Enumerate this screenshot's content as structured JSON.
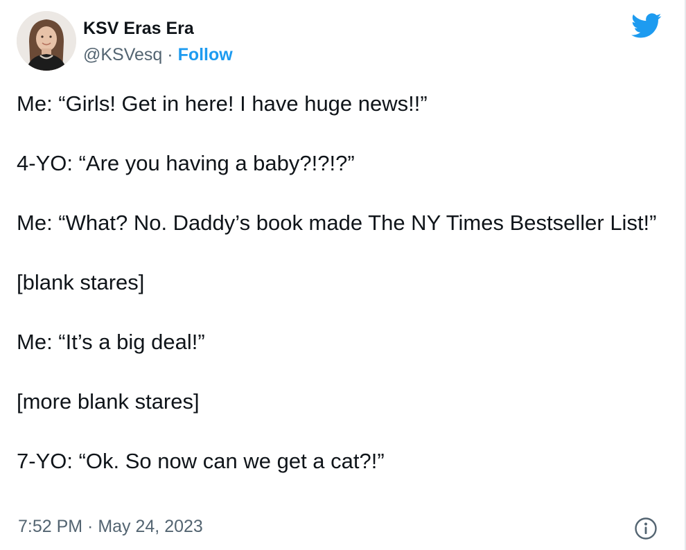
{
  "author": {
    "display_name": "KSV Eras Era",
    "handle": "@KSVesq",
    "separator": " · ",
    "follow_label": "Follow"
  },
  "icons": {
    "logo": "twitter-bird-icon",
    "info": "info-circle-icon"
  },
  "colors": {
    "accent": "#1d9bf0",
    "text_primary": "#0f1419",
    "text_secondary": "#536471"
  },
  "tweet": {
    "paragraphs": [
      "Me: “Girls! Get in here! I have huge news!!”",
      "4-YO: “Are you having a baby?!?!?”",
      "Me: “What? No. Daddy’s book made The NY Times Bestseller List!”",
      "[blank stares]",
      "Me: “It’s a big deal!”",
      "[more blank stares]",
      "7-YO: “Ok. So now can we get a cat?!”"
    ],
    "timestamp": "7:52 PM · May 24, 2023"
  }
}
